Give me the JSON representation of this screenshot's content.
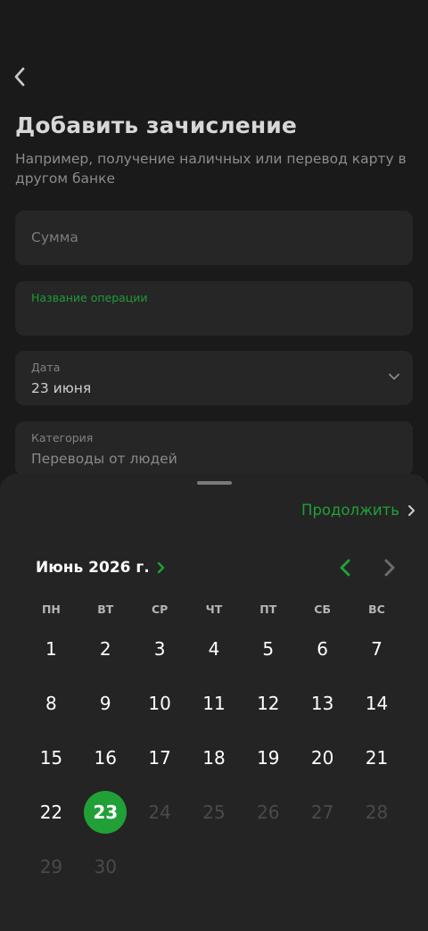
{
  "colors": {
    "accent": "#21a038",
    "background": "#1a1a1a",
    "field": "#262626",
    "sheet": "#242424"
  },
  "icons": {
    "back": "chevron-left-icon",
    "dropdown": "chevron-down-icon",
    "continue": "chevron-right-icon",
    "month_picker": "chevron-right-icon",
    "prev_month": "chevron-left-icon",
    "next_month": "chevron-right-icon"
  },
  "header": {
    "title": "Добавить зачисление",
    "subtitle": "Например, получение наличных или перевод карту в другом банке"
  },
  "form": {
    "amount": {
      "placeholder": "Сумма"
    },
    "operation_name": {
      "label": "Название операции",
      "value": ""
    },
    "date": {
      "label": "Дата",
      "value": "23 июня"
    },
    "category": {
      "label": "Категория",
      "value": "Переводы от людей"
    }
  },
  "calendar": {
    "continue_label": "Продолжить",
    "month_label": "Июнь 2026 г.",
    "weekdays": [
      "ПН",
      "ВТ",
      "СР",
      "ЧТ",
      "ПТ",
      "СБ",
      "ВС"
    ],
    "selected_day": "23",
    "days": [
      {
        "label": "1",
        "state": "enabled"
      },
      {
        "label": "2",
        "state": "enabled"
      },
      {
        "label": "3",
        "state": "enabled"
      },
      {
        "label": "4",
        "state": "enabled"
      },
      {
        "label": "5",
        "state": "enabled"
      },
      {
        "label": "6",
        "state": "enabled"
      },
      {
        "label": "7",
        "state": "enabled"
      },
      {
        "label": "8",
        "state": "enabled"
      },
      {
        "label": "9",
        "state": "enabled"
      },
      {
        "label": "10",
        "state": "enabled"
      },
      {
        "label": "11",
        "state": "enabled"
      },
      {
        "label": "12",
        "state": "enabled"
      },
      {
        "label": "13",
        "state": "enabled"
      },
      {
        "label": "14",
        "state": "enabled"
      },
      {
        "label": "15",
        "state": "enabled"
      },
      {
        "label": "16",
        "state": "enabled"
      },
      {
        "label": "17",
        "state": "enabled"
      },
      {
        "label": "18",
        "state": "enabled"
      },
      {
        "label": "19",
        "state": "enabled"
      },
      {
        "label": "20",
        "state": "enabled"
      },
      {
        "label": "21",
        "state": "enabled"
      },
      {
        "label": "22",
        "state": "enabled"
      },
      {
        "label": "23",
        "state": "selected"
      },
      {
        "label": "24",
        "state": "disabled"
      },
      {
        "label": "25",
        "state": "disabled"
      },
      {
        "label": "26",
        "state": "disabled"
      },
      {
        "label": "27",
        "state": "disabled"
      },
      {
        "label": "28",
        "state": "disabled"
      },
      {
        "label": "29",
        "state": "disabled"
      },
      {
        "label": "30",
        "state": "disabled"
      }
    ]
  }
}
